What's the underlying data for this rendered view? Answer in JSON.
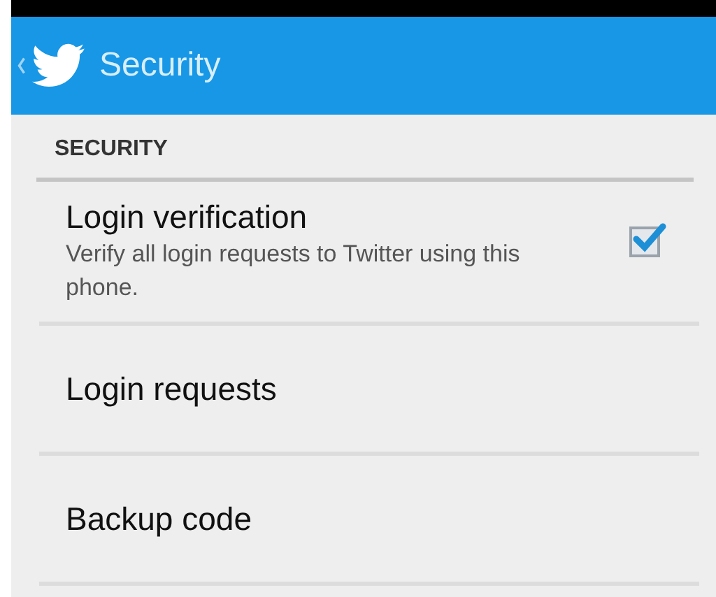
{
  "action_bar": {
    "title": "Security"
  },
  "section": {
    "header": "SECURITY"
  },
  "items": [
    {
      "kind": "checkbox",
      "title": "Login verification",
      "summary": "Verify all login requests to Twitter using this phone.",
      "checked": true
    },
    {
      "kind": "plain",
      "title": "Login requests"
    },
    {
      "kind": "plain",
      "title": "Backup code"
    }
  ]
}
